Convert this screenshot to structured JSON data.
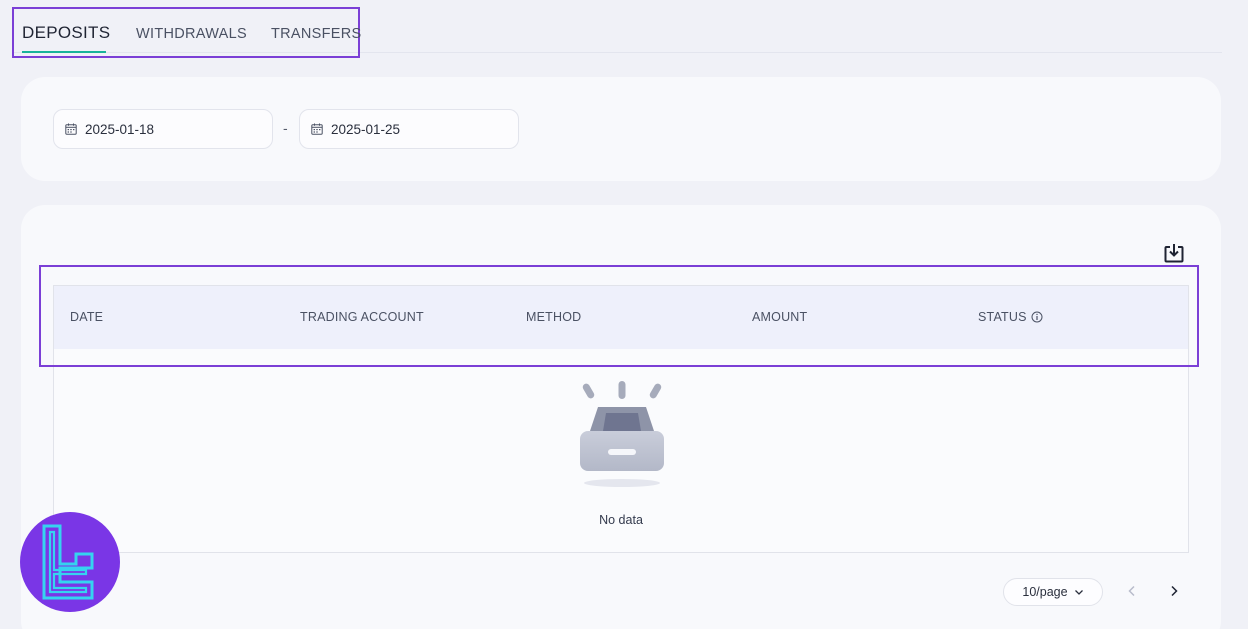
{
  "tabs": [
    {
      "label": "DEPOSITS",
      "active": true
    },
    {
      "label": "WITHDRAWALS",
      "active": false
    },
    {
      "label": "TRANSFERS",
      "active": false
    }
  ],
  "filters": {
    "start_date": "2025-01-18",
    "end_date": "2025-01-25",
    "separator": "-",
    "calendar_icon": "calendar-icon"
  },
  "table": {
    "columns": [
      "DATE",
      "TRADING ACCOUNT",
      "METHOD",
      "AMOUNT",
      "STATUS"
    ],
    "status_info_icon": "info-icon",
    "empty_text": "No data",
    "export_icon": "download-icon"
  },
  "pagination": {
    "page_size": "10/page"
  },
  "colors": {
    "accent": "#19b39a",
    "highlight": "#7b3fd6",
    "logo_bg": "#7a36e6",
    "logo_fg": "#35d3f0"
  }
}
